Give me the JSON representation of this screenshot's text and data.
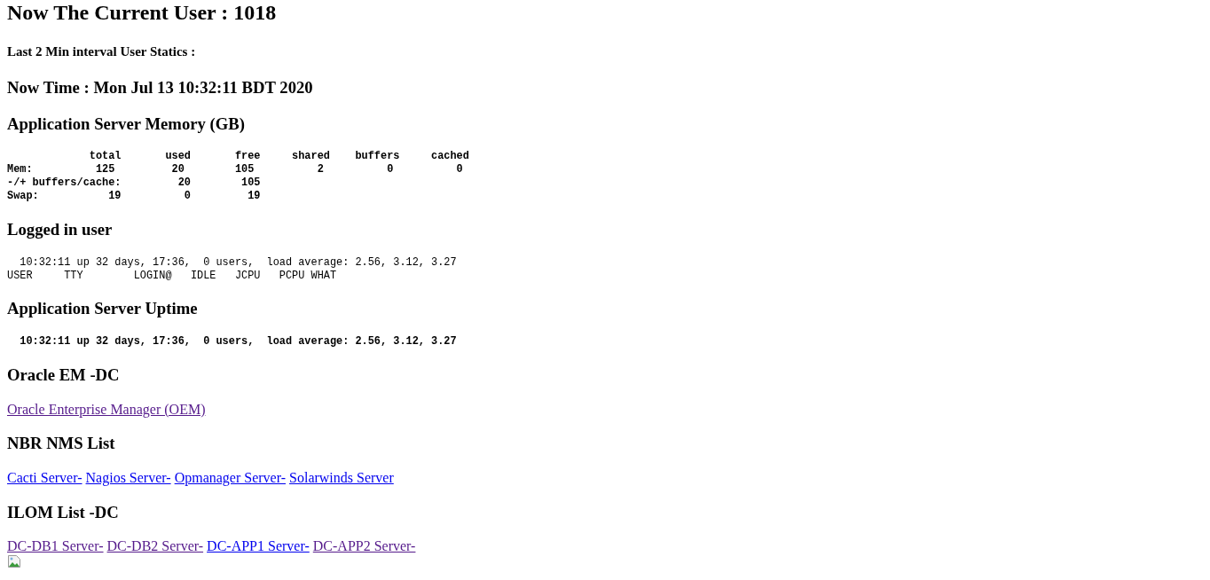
{
  "sections": [
    {
      "kind": "title",
      "text": "Now The Current User : 1018"
    },
    {
      "kind": "subheading",
      "text": "Last 2 Min interval User Statics :"
    },
    {
      "kind": "heading",
      "text": "Now Time : Mon Jul 13 10:32:11 BDT 2020"
    },
    {
      "kind": "heading",
      "text": "Application Server Memory (GB)"
    },
    {
      "kind": "pre",
      "bold": true,
      "lines": [
        "             total       used       free     shared    buffers     cached",
        "Mem:          125         20        105          2          0          0",
        "-/+ buffers/cache:         20        105",
        "Swap:           19          0         19"
      ]
    },
    {
      "kind": "heading",
      "text": "Logged in user"
    },
    {
      "kind": "pre",
      "bold": false,
      "lines": [
        "  10:32:11 up 32 days, 17:36,  0 users,  load average: 2.56, 3.12, 3.27",
        "USER     TTY        LOGIN@   IDLE   JCPU   PCPU WHAT"
      ]
    },
    {
      "kind": "heading",
      "text": "Application Server Uptime"
    },
    {
      "kind": "pre",
      "bold": true,
      "lines": [
        "  10:32:11 up 32 days, 17:36,  0 users,  load average: 2.56, 3.12, 3.27"
      ]
    },
    {
      "kind": "heading",
      "text": "Oracle EM -DC"
    },
    {
      "kind": "links",
      "links": [
        {
          "text": "Oracle Enterprise Manager (OEM)",
          "visited": true
        }
      ]
    },
    {
      "kind": "heading",
      "text": "NBR NMS List"
    },
    {
      "kind": "links",
      "links": [
        {
          "text": "Cacti Server-",
          "visited": false
        },
        {
          "text": "Nagios Server-",
          "visited": false
        },
        {
          "text": "Opmanager Server-",
          "visited": false
        },
        {
          "text": "Solarwinds Server",
          "visited": false
        }
      ]
    },
    {
      "kind": "heading",
      "text": "ILOM List -DC"
    },
    {
      "kind": "links",
      "links": [
        {
          "text": "DC-DB1 Server-",
          "visited": true
        },
        {
          "text": "DC-DB2 Server-",
          "visited": true
        },
        {
          "text": "DC-APP1 Server-",
          "visited": false
        },
        {
          "text": "DC-APP2 Server-",
          "visited": true
        }
      ]
    },
    {
      "kind": "image"
    }
  ]
}
